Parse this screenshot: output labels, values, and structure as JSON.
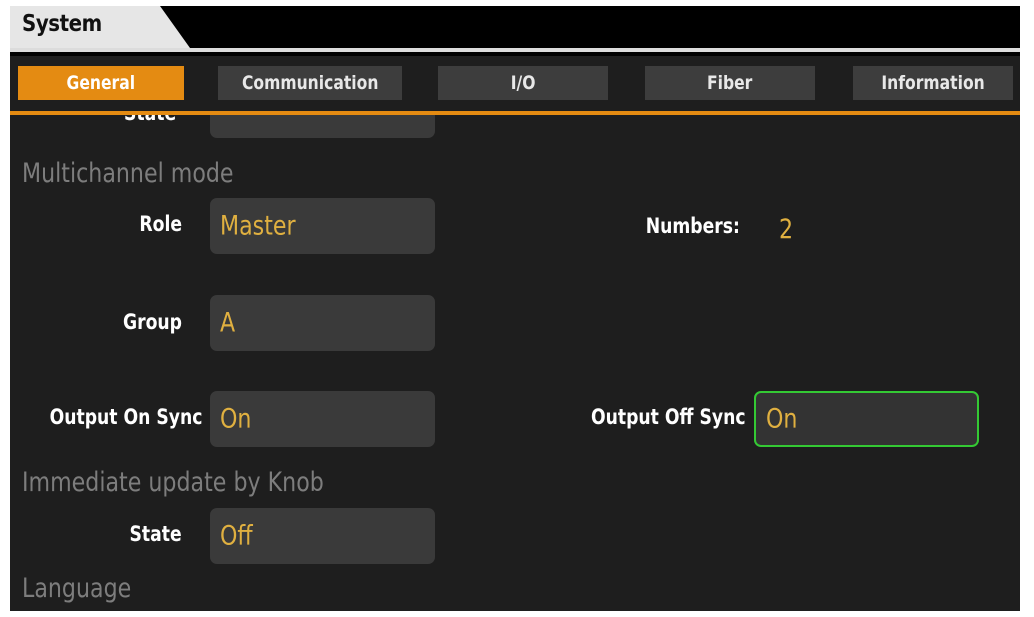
{
  "window": {
    "title": "System"
  },
  "tabs": [
    {
      "label": "General",
      "active": true
    },
    {
      "label": "Communication",
      "active": false
    },
    {
      "label": "I/O",
      "active": false
    },
    {
      "label": "Fiber",
      "active": false
    },
    {
      "label": "Information",
      "active": false
    }
  ],
  "content": {
    "partial_label": "State",
    "multichannel": {
      "section_title": "Multichannel mode",
      "role_label": "Role",
      "role_value": "Master",
      "numbers_label": "Numbers:",
      "numbers_value": "2",
      "group_label": "Group",
      "group_value": "A",
      "output_on_sync_label": "Output On Sync",
      "output_on_sync_value": "On",
      "output_off_sync_label": "Output Off Sync",
      "output_off_sync_value": "On"
    },
    "knob": {
      "section_title": "Immediate update by Knob",
      "state_label": "State",
      "state_value": "Off"
    },
    "language": {
      "section_title": "Language"
    }
  },
  "colors": {
    "accent": "#e48b12",
    "value_text": "#e0b040",
    "focus_border": "#34c934",
    "section_text": "#7d7d7d",
    "panel_bg": "#1e1e1e",
    "field_bg": "#3a3a3a"
  }
}
